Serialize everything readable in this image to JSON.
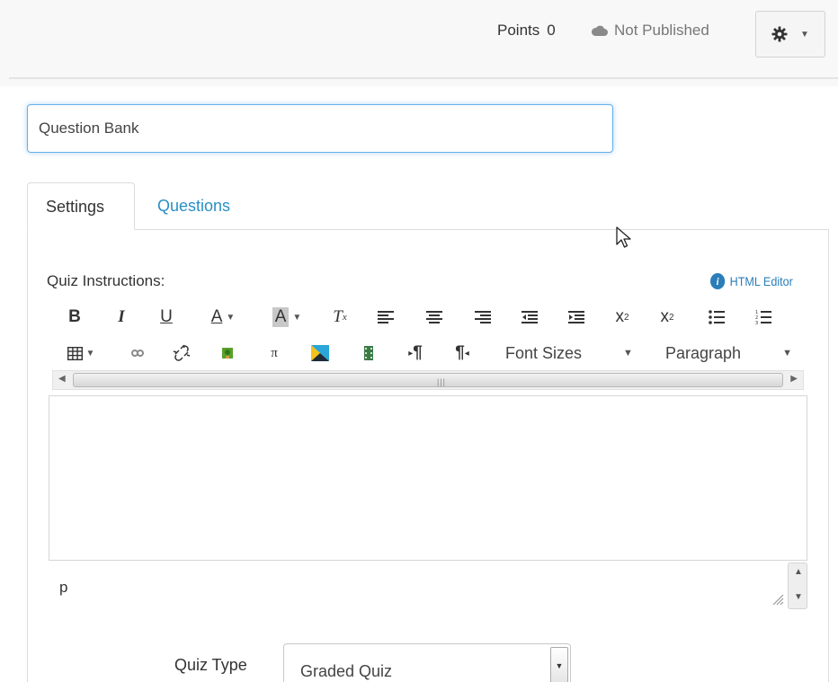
{
  "header": {
    "points_label": "Points",
    "points_value": "0",
    "publish_status": "Not Published",
    "settings_icon": "gear-icon"
  },
  "title_field": {
    "value": "Question Bank"
  },
  "tabs": [
    {
      "label": "Settings",
      "active": true
    },
    {
      "label": "Questions",
      "active": false
    }
  ],
  "editor": {
    "label": "Quiz Instructions:",
    "html_editor_link": "HTML Editor",
    "font_sizes_label": "Font Sizes",
    "paragraph_label": "Paragraph",
    "toolbar_row1": [
      "bold-icon",
      "italic-icon",
      "underline-icon",
      "text-color-icon",
      "background-color-icon",
      "clear-formatting-icon",
      "align-left-icon",
      "align-center-icon",
      "align-right-icon",
      "outdent-icon",
      "indent-icon",
      "superscript-icon",
      "subscript-icon",
      "bullet-list-icon",
      "numbered-list-icon"
    ],
    "toolbar_row2": [
      "table-icon",
      "link-icon",
      "unlink-icon",
      "image-icon",
      "math-icon",
      "media-icon",
      "video-icon",
      "ltr-icon",
      "rtl-icon"
    ],
    "status_path": "p"
  },
  "quiz_type": {
    "label": "Quiz Type",
    "selected": "Graded Quiz"
  },
  "colors": {
    "accent": "#2a8fc4",
    "focus_border": "#66afe9",
    "header_bg": "#f8f8f8"
  }
}
